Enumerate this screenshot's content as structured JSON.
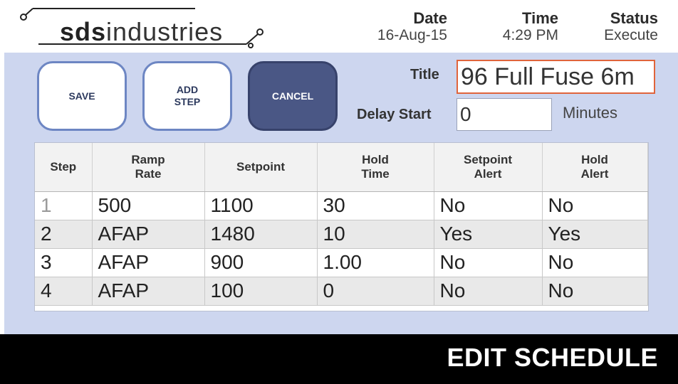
{
  "logo": {
    "bold": "sds",
    "light": "industries"
  },
  "header": {
    "date_label": "Date",
    "date_value": "16-Aug-15",
    "time_label": "Time",
    "time_value": "4:29 PM",
    "status_label": "Status",
    "status_value": "Execute"
  },
  "buttons": {
    "save": "SAVE",
    "add_step_line1": "ADD",
    "add_step_line2": "STEP",
    "cancel": "CANCEL"
  },
  "form": {
    "title_label": "Title",
    "title_value": "96 Full Fuse 6m",
    "delay_label": "Delay Start",
    "delay_value": "0",
    "delay_unit": "Minutes"
  },
  "table": {
    "headers": [
      {
        "line1": "Step",
        "line2": ""
      },
      {
        "line1": "Ramp",
        "line2": "Rate"
      },
      {
        "line1": "Setpoint",
        "line2": ""
      },
      {
        "line1": "Hold",
        "line2": "Time"
      },
      {
        "line1": "Setpoint",
        "line2": "Alert"
      },
      {
        "line1": "Hold",
        "line2": "Alert"
      }
    ],
    "rows": [
      [
        "1",
        "500",
        "1100",
        "30",
        "No",
        "No"
      ],
      [
        "2",
        "AFAP",
        "1480",
        "10",
        "Yes",
        "Yes"
      ],
      [
        "3",
        "AFAP",
        "900",
        "1.00",
        "No",
        "No"
      ],
      [
        "4",
        "AFAP",
        "100",
        "0",
        "No",
        "No"
      ]
    ]
  },
  "footer": {
    "title": "EDIT SCHEDULE"
  },
  "colors": {
    "panel_bg": "#cdd6ef",
    "button_border": "#6d86c3",
    "cancel_bg": "#4a5785",
    "title_border": "#e0643b",
    "footer_bg": "#000000"
  }
}
